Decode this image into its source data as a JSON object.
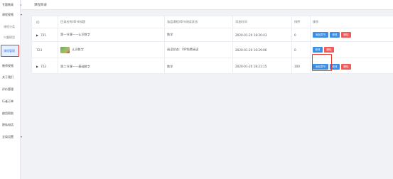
{
  "sidebar": {
    "items": [
      {
        "label": "专题教具",
        "caret": "▸"
      },
      {
        "label": "课程视频",
        "caret": "▾"
      },
      {
        "label": "课程分类"
      },
      {
        "label": "兴趣模型"
      },
      {
        "label": "课程管理"
      },
      {
        "label": "教师视频"
      },
      {
        "label": "关于我们"
      },
      {
        "label": "评价管理"
      },
      {
        "label": "行者订单"
      },
      {
        "label": "使用帮助"
      },
      {
        "label": "隐私电话"
      },
      {
        "label": "全局设置",
        "caret": "▾"
      }
    ]
  },
  "breadcrumb": {
    "text": "课程目录"
  },
  "table": {
    "headers": {
      "id": "ID",
      "name": "目录名称/章节标题",
      "status": "该层课程/章节阅读状态",
      "time": "添加时间",
      "sort": "排序",
      "ops": "操作"
    },
    "rows": [
      {
        "arrow": "▶",
        "id": "721",
        "name": "第一节课——认识数字",
        "status": "数学",
        "time": "2020-01-20 18:20:43",
        "sort": "0"
      },
      {
        "arrow": "",
        "id": "723",
        "name": "认识数字",
        "status": "阅读状态：VIP免费阅读",
        "time": "2020-01-20 16:29:06",
        "sort": "0"
      },
      {
        "arrow": "▶",
        "id": "722",
        "name": "第二节课——基础数字",
        "status": "数学",
        "time": "2020-01-20 18:21:15",
        "sort": "100"
      }
    ],
    "buttons": {
      "add_chapter": "添加章节",
      "edit": "修改",
      "delete": "删除"
    }
  },
  "colors": {
    "primary": "#3a8ee6",
    "danger": "#f05a5a",
    "highlight": "#e53935"
  }
}
